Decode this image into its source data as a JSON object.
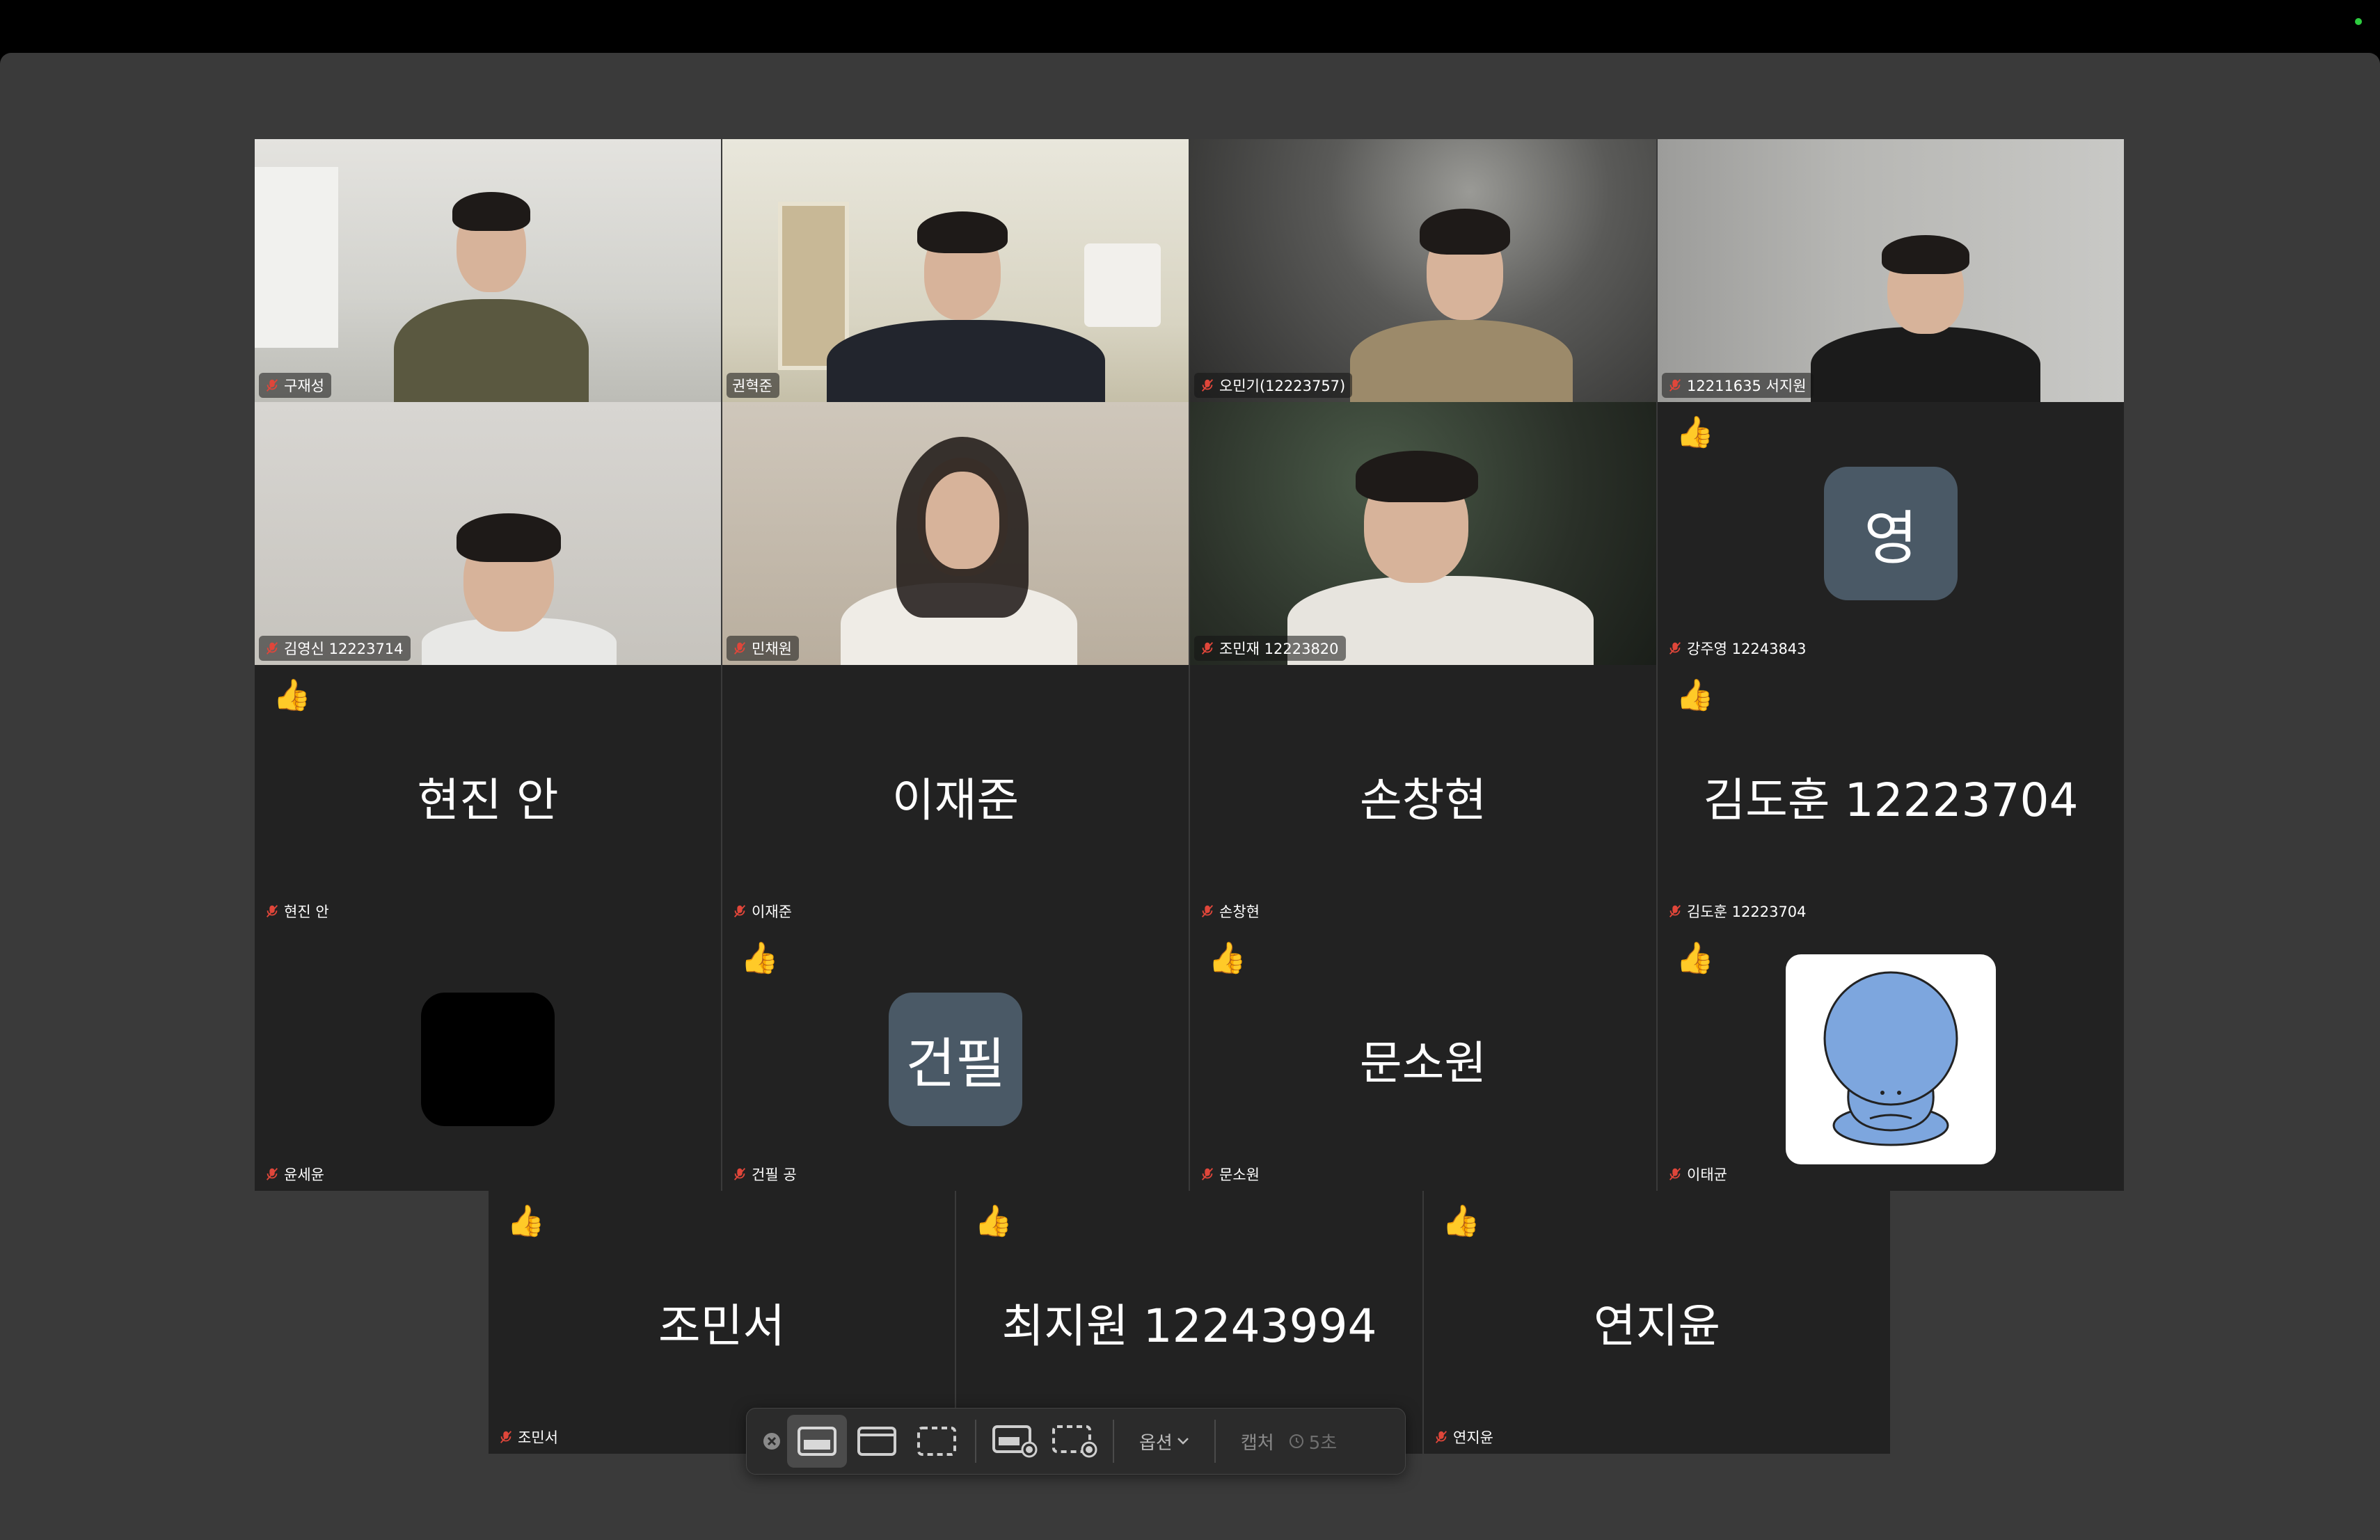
{
  "grid": {
    "row1": [
      {
        "name": "구재성"
      },
      {
        "name": "권혁준"
      },
      {
        "name": "오민기(12223757)"
      },
      {
        "name": "12211635 서지원"
      }
    ],
    "row2": [
      {
        "name": "김영신 12223714"
      },
      {
        "name": "민채원"
      },
      {
        "name": "조민재 12223820"
      },
      {
        "name": "강주영 12243843",
        "avatar_letter": "영"
      }
    ],
    "row3": [
      {
        "name": "현진 안",
        "big": "현진 안"
      },
      {
        "name": "이재준",
        "big": "이재준"
      },
      {
        "name": "손창현",
        "big": "손창현"
      },
      {
        "name": "김도훈 12223704",
        "big": "김도훈 12223704"
      }
    ],
    "row4": [
      {
        "name": "윤세윤"
      },
      {
        "name": "건필 공",
        "avatar_letter": "건필"
      },
      {
        "name": "문소원",
        "big": "문소원"
      },
      {
        "name": "이태균"
      }
    ],
    "row5": [
      {
        "name": "조민서",
        "big": "조민서"
      },
      {
        "name": "",
        "big": "최지원 12243994"
      },
      {
        "name": "연지윤",
        "big": "연지윤"
      }
    ]
  },
  "reaction_emoji": "👍",
  "toolbar": {
    "options_label": "옵션",
    "capture_label": "캡처",
    "timer_label": "5초"
  },
  "colors": {
    "tile_bg": "#222222",
    "active_border": "#27c23d",
    "avatar_slate": "#4a5966",
    "mute_red": "#e0463a"
  }
}
